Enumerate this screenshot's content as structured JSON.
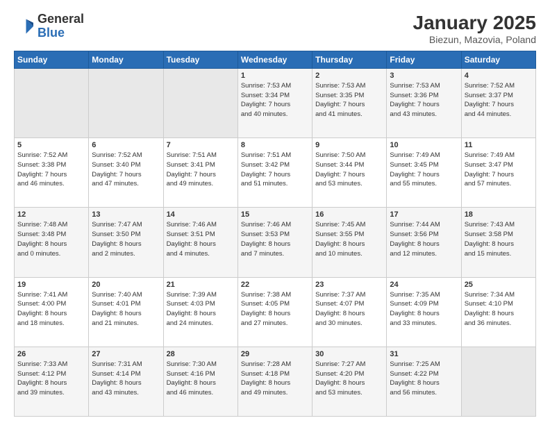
{
  "header": {
    "logo_general": "General",
    "logo_blue": "Blue",
    "title": "January 2025",
    "subtitle": "Biezun, Mazovia, Poland"
  },
  "calendar": {
    "days_of_week": [
      "Sunday",
      "Monday",
      "Tuesday",
      "Wednesday",
      "Thursday",
      "Friday",
      "Saturday"
    ],
    "weeks": [
      [
        {
          "day": "",
          "info": ""
        },
        {
          "day": "",
          "info": ""
        },
        {
          "day": "",
          "info": ""
        },
        {
          "day": "1",
          "info": "Sunrise: 7:53 AM\nSunset: 3:34 PM\nDaylight: 7 hours\nand 40 minutes."
        },
        {
          "day": "2",
          "info": "Sunrise: 7:53 AM\nSunset: 3:35 PM\nDaylight: 7 hours\nand 41 minutes."
        },
        {
          "day": "3",
          "info": "Sunrise: 7:53 AM\nSunset: 3:36 PM\nDaylight: 7 hours\nand 43 minutes."
        },
        {
          "day": "4",
          "info": "Sunrise: 7:52 AM\nSunset: 3:37 PM\nDaylight: 7 hours\nand 44 minutes."
        }
      ],
      [
        {
          "day": "5",
          "info": "Sunrise: 7:52 AM\nSunset: 3:38 PM\nDaylight: 7 hours\nand 46 minutes."
        },
        {
          "day": "6",
          "info": "Sunrise: 7:52 AM\nSunset: 3:40 PM\nDaylight: 7 hours\nand 47 minutes."
        },
        {
          "day": "7",
          "info": "Sunrise: 7:51 AM\nSunset: 3:41 PM\nDaylight: 7 hours\nand 49 minutes."
        },
        {
          "day": "8",
          "info": "Sunrise: 7:51 AM\nSunset: 3:42 PM\nDaylight: 7 hours\nand 51 minutes."
        },
        {
          "day": "9",
          "info": "Sunrise: 7:50 AM\nSunset: 3:44 PM\nDaylight: 7 hours\nand 53 minutes."
        },
        {
          "day": "10",
          "info": "Sunrise: 7:49 AM\nSunset: 3:45 PM\nDaylight: 7 hours\nand 55 minutes."
        },
        {
          "day": "11",
          "info": "Sunrise: 7:49 AM\nSunset: 3:47 PM\nDaylight: 7 hours\nand 57 minutes."
        }
      ],
      [
        {
          "day": "12",
          "info": "Sunrise: 7:48 AM\nSunset: 3:48 PM\nDaylight: 8 hours\nand 0 minutes."
        },
        {
          "day": "13",
          "info": "Sunrise: 7:47 AM\nSunset: 3:50 PM\nDaylight: 8 hours\nand 2 minutes."
        },
        {
          "day": "14",
          "info": "Sunrise: 7:46 AM\nSunset: 3:51 PM\nDaylight: 8 hours\nand 4 minutes."
        },
        {
          "day": "15",
          "info": "Sunrise: 7:46 AM\nSunset: 3:53 PM\nDaylight: 8 hours\nand 7 minutes."
        },
        {
          "day": "16",
          "info": "Sunrise: 7:45 AM\nSunset: 3:55 PM\nDaylight: 8 hours\nand 10 minutes."
        },
        {
          "day": "17",
          "info": "Sunrise: 7:44 AM\nSunset: 3:56 PM\nDaylight: 8 hours\nand 12 minutes."
        },
        {
          "day": "18",
          "info": "Sunrise: 7:43 AM\nSunset: 3:58 PM\nDaylight: 8 hours\nand 15 minutes."
        }
      ],
      [
        {
          "day": "19",
          "info": "Sunrise: 7:41 AM\nSunset: 4:00 PM\nDaylight: 8 hours\nand 18 minutes."
        },
        {
          "day": "20",
          "info": "Sunrise: 7:40 AM\nSunset: 4:01 PM\nDaylight: 8 hours\nand 21 minutes."
        },
        {
          "day": "21",
          "info": "Sunrise: 7:39 AM\nSunset: 4:03 PM\nDaylight: 8 hours\nand 24 minutes."
        },
        {
          "day": "22",
          "info": "Sunrise: 7:38 AM\nSunset: 4:05 PM\nDaylight: 8 hours\nand 27 minutes."
        },
        {
          "day": "23",
          "info": "Sunrise: 7:37 AM\nSunset: 4:07 PM\nDaylight: 8 hours\nand 30 minutes."
        },
        {
          "day": "24",
          "info": "Sunrise: 7:35 AM\nSunset: 4:09 PM\nDaylight: 8 hours\nand 33 minutes."
        },
        {
          "day": "25",
          "info": "Sunrise: 7:34 AM\nSunset: 4:10 PM\nDaylight: 8 hours\nand 36 minutes."
        }
      ],
      [
        {
          "day": "26",
          "info": "Sunrise: 7:33 AM\nSunset: 4:12 PM\nDaylight: 8 hours\nand 39 minutes."
        },
        {
          "day": "27",
          "info": "Sunrise: 7:31 AM\nSunset: 4:14 PM\nDaylight: 8 hours\nand 43 minutes."
        },
        {
          "day": "28",
          "info": "Sunrise: 7:30 AM\nSunset: 4:16 PM\nDaylight: 8 hours\nand 46 minutes."
        },
        {
          "day": "29",
          "info": "Sunrise: 7:28 AM\nSunset: 4:18 PM\nDaylight: 8 hours\nand 49 minutes."
        },
        {
          "day": "30",
          "info": "Sunrise: 7:27 AM\nSunset: 4:20 PM\nDaylight: 8 hours\nand 53 minutes."
        },
        {
          "day": "31",
          "info": "Sunrise: 7:25 AM\nSunset: 4:22 PM\nDaylight: 8 hours\nand 56 minutes."
        },
        {
          "day": "",
          "info": ""
        }
      ]
    ]
  }
}
